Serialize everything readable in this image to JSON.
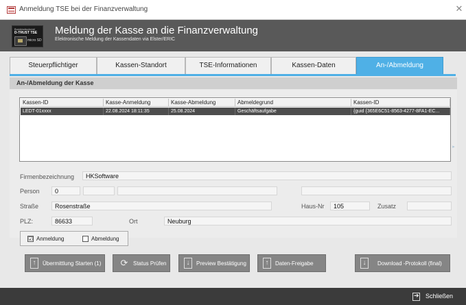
{
  "window": {
    "title": "Anmeldung TSE bei der Finanzverwaltung"
  },
  "header": {
    "title": "Meldung der Kasse an die Finanzverwaltung",
    "subtitle": "Elektronische Meldung der Kassendaten via Elster/ERIC",
    "logo": {
      "line1": "Bundesdruckerei",
      "line2": "D-TRUST TSE",
      "line3": "micro SD"
    }
  },
  "tabs": [
    {
      "label": "Steuerpflichtiger",
      "active": false
    },
    {
      "label": "Kassen-Standort",
      "active": false
    },
    {
      "label": "TSE-Informationen",
      "active": false
    },
    {
      "label": "Kassen-Daten",
      "active": false
    },
    {
      "label": "An-/Abmeldung",
      "active": true
    }
  ],
  "section": {
    "title": "An-/Abmeldung der Kasse"
  },
  "list": {
    "columns": [
      "Kassen-ID",
      "Kasse-Anmeldung",
      "Kasse-Abmeldung",
      "Abmeldegrund",
      "Kassen-ID"
    ],
    "rows": [
      [
        "LEDT-01xxxx",
        "22.08.2024 18:11:35",
        "25.08.2024",
        "Geschäftsaufgabe",
        "{guid {365E6C51-8563-4277-8FA1-EC..."
      ]
    ]
  },
  "form": {
    "firmenbezeichnung": {
      "label": "Firmenbezeichnung",
      "value": "HKSoftware"
    },
    "person": {
      "label": "Person",
      "value": "0"
    },
    "strasse": {
      "label": "Straße",
      "value": "Rosenstraße"
    },
    "hausnr": {
      "label": "Haus-Nr",
      "value": "105"
    },
    "zusatz": {
      "label": "Zusatz",
      "value": ""
    },
    "plz": {
      "label": "PLZ:",
      "value": "86633"
    },
    "ort": {
      "label": "Ort",
      "value": "Neuburg"
    }
  },
  "checkboxes": {
    "anmeldung": {
      "label": "Anmeldung",
      "checked": true,
      "mark": "☑"
    },
    "abmeldung": {
      "label": "Abmeldung",
      "checked": false,
      "mark": ""
    }
  },
  "buttons": {
    "start": "Übermittlung Starten (1)",
    "status": "Status Prüfen",
    "preview": "Preview Bestätigung",
    "freigabe": "Daten-Freigabe",
    "download": "Download -Protokoll (final)"
  },
  "footer": {
    "close_label": "Schließen"
  },
  "colors": {
    "accent": "#4fb0e6",
    "header_bg": "#595959",
    "selected_row": "#4d4d4d",
    "button_bg": "#858585",
    "footer_bg": "#3b3b3b"
  }
}
